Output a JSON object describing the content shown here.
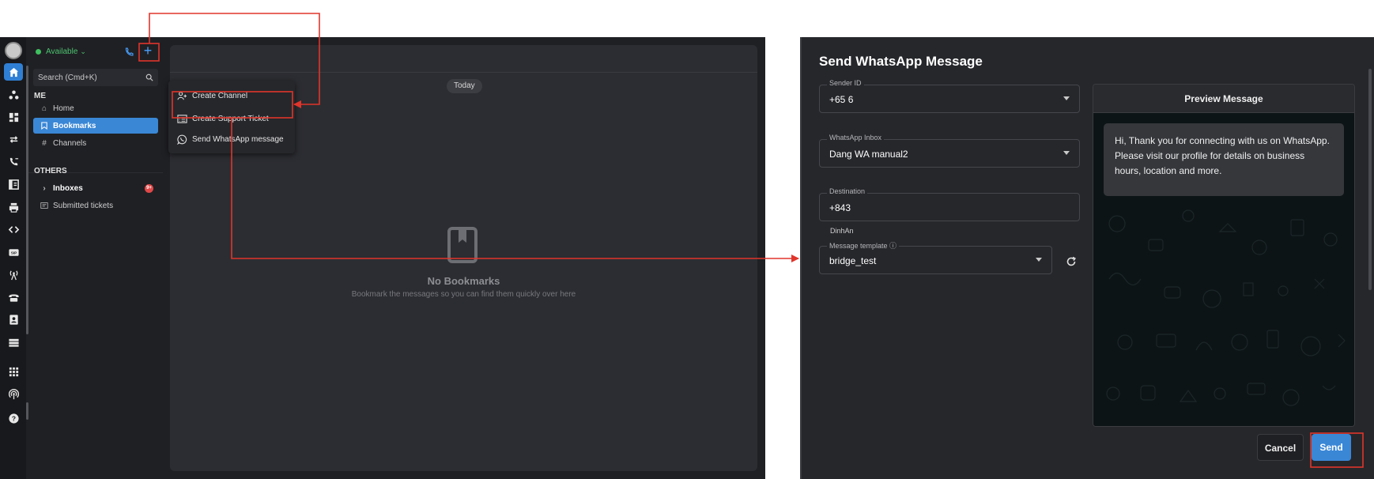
{
  "left_app": {
    "status": {
      "label": "Available",
      "color": "#3fbf5f"
    },
    "search": {
      "placeholder": "Search (Cmd+K)"
    },
    "sections": {
      "me": "ME",
      "others": "OTHERS"
    },
    "nav": {
      "home": "Home",
      "bookmarks": "Bookmarks",
      "channels": "Channels",
      "inboxes": "Inboxes",
      "inboxes_badge": "9+",
      "submitted": "Submitted tickets"
    },
    "menu": {
      "create_channel": "Create Channel",
      "create_ticket": "Create Support Ticket",
      "send_whatsapp": "Send WhatsApp message"
    },
    "content": {
      "today": "Today",
      "empty_title": "No Bookmarks",
      "empty_sub": "Bookmark the messages so you can find them quickly over here"
    },
    "rail_icons": [
      "home-icon",
      "people-icon",
      "dashboard-icon",
      "transfer-icon",
      "call-log-icon",
      "ledger-icon",
      "print-icon",
      "code-icon",
      "sip-icon",
      "antenna-icon",
      "telephone-icon",
      "contact-card-icon",
      "server-icon",
      "apps-grid-icon",
      "broadcast-icon",
      "help-icon"
    ]
  },
  "dialog": {
    "title": "Send WhatsApp Message",
    "sender_id": {
      "label": "Sender ID",
      "value": "+65 6"
    },
    "inbox": {
      "label": "WhatsApp Inbox",
      "value": "Dang WA manual2"
    },
    "destination": {
      "label": "Destination",
      "value": "+843",
      "name": "DinhAn"
    },
    "template": {
      "label": "Message template ⓘ",
      "value": "bridge_test"
    },
    "preview": {
      "title": "Preview Message",
      "message": "Hi, Thank you for connecting with us on WhatsApp. Please visit our profile for details on business hours, location and more."
    },
    "buttons": {
      "cancel": "Cancel",
      "send": "Send"
    }
  },
  "colors": {
    "accent": "#3a87d6",
    "annotation": "#e0352b",
    "status_green": "#3fbf5f",
    "badge": "#e04848"
  }
}
